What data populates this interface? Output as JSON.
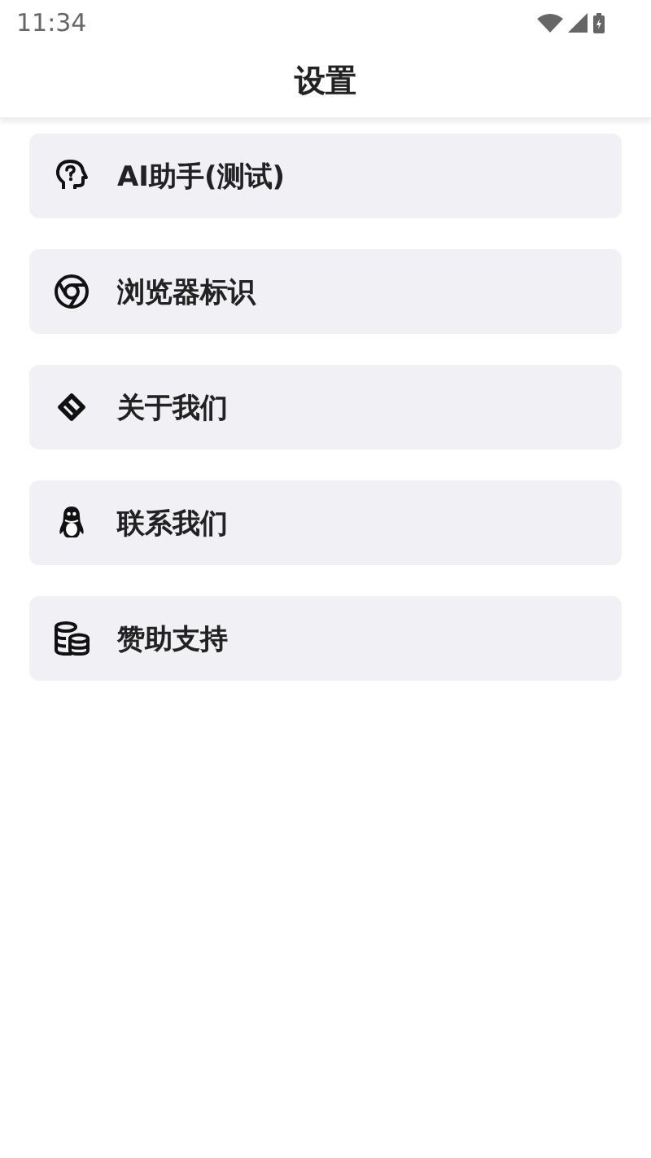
{
  "status_bar": {
    "time": "11:34"
  },
  "header": {
    "title": "设置"
  },
  "items": [
    {
      "label": "AI助手(测试)"
    },
    {
      "label": "浏览器标识"
    },
    {
      "label": "关于我们"
    },
    {
      "label": "联系我们"
    },
    {
      "label": "赞助支持"
    }
  ]
}
